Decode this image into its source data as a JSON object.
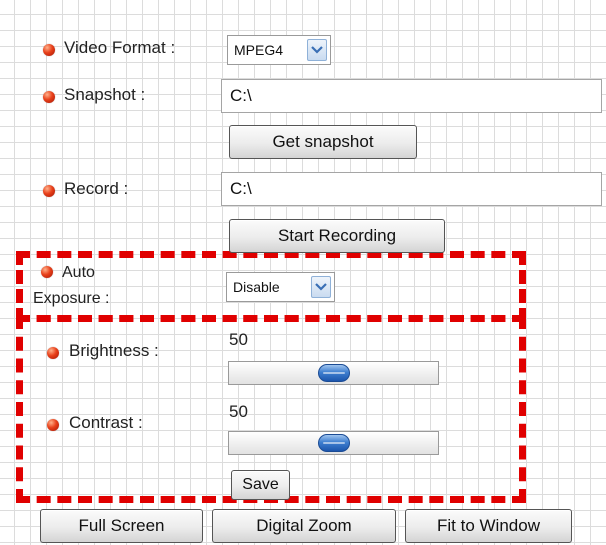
{
  "video_format": {
    "label": "Video Format :",
    "selected": "MPEG4"
  },
  "snapshot": {
    "label": "Snapshot :",
    "path": "C:\\",
    "button_label": "Get snapshot"
  },
  "record": {
    "label": "Record :",
    "path": "C:\\",
    "button_label": "Start Recording"
  },
  "auto_exposure": {
    "label_line1": "Auto",
    "label_line2": "Exposure :",
    "selected": "Disable"
  },
  "brightness": {
    "label": "Brightness :",
    "value": "50",
    "level": 0.5
  },
  "contrast": {
    "label": "Contrast :",
    "value": "50",
    "level": 0.5
  },
  "save_label": "Save",
  "bottom_buttons": {
    "full_screen": "Full Screen",
    "digital_zoom": "Digital Zoom",
    "fit_to_window": "Fit to Window"
  },
  "colors": {
    "highlight": "#e00000",
    "bullet": "#e8401a",
    "slider_thumb": "#3f7fd0",
    "dropdown_accent": "#8fb1d8"
  },
  "icons": {
    "bullet": "orange-ball-bullet-icon",
    "dropdown": "chevron-down-icon"
  }
}
